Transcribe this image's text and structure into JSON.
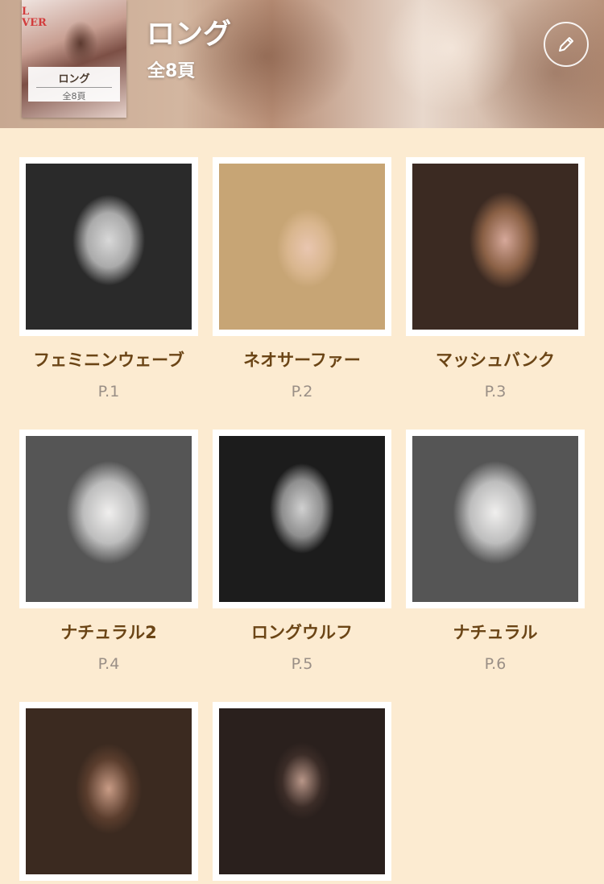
{
  "header": {
    "title": "ロング",
    "subtitle": "全8頁",
    "cover": {
      "mag_text": "L\nVER",
      "title": "ロング",
      "pages": "全8頁"
    },
    "edit_icon": "pencil-icon"
  },
  "styles": [
    {
      "title": "フェミニンウェーブ",
      "page": "P.1"
    },
    {
      "title": "ネオサーファー",
      "page": "P.2"
    },
    {
      "title": "マッシュバンク",
      "page": "P.3"
    },
    {
      "title": "ナチュラル2",
      "page": "P.4"
    },
    {
      "title": "ロングウルフ",
      "page": "P.5"
    },
    {
      "title": "ナチュラル",
      "page": "P.6"
    },
    {
      "title": "",
      "page": ""
    },
    {
      "title": "",
      "page": ""
    }
  ],
  "colors": {
    "background": "#fcebd1",
    "title_text": "#6b4516",
    "page_text": "#9a8f86"
  }
}
